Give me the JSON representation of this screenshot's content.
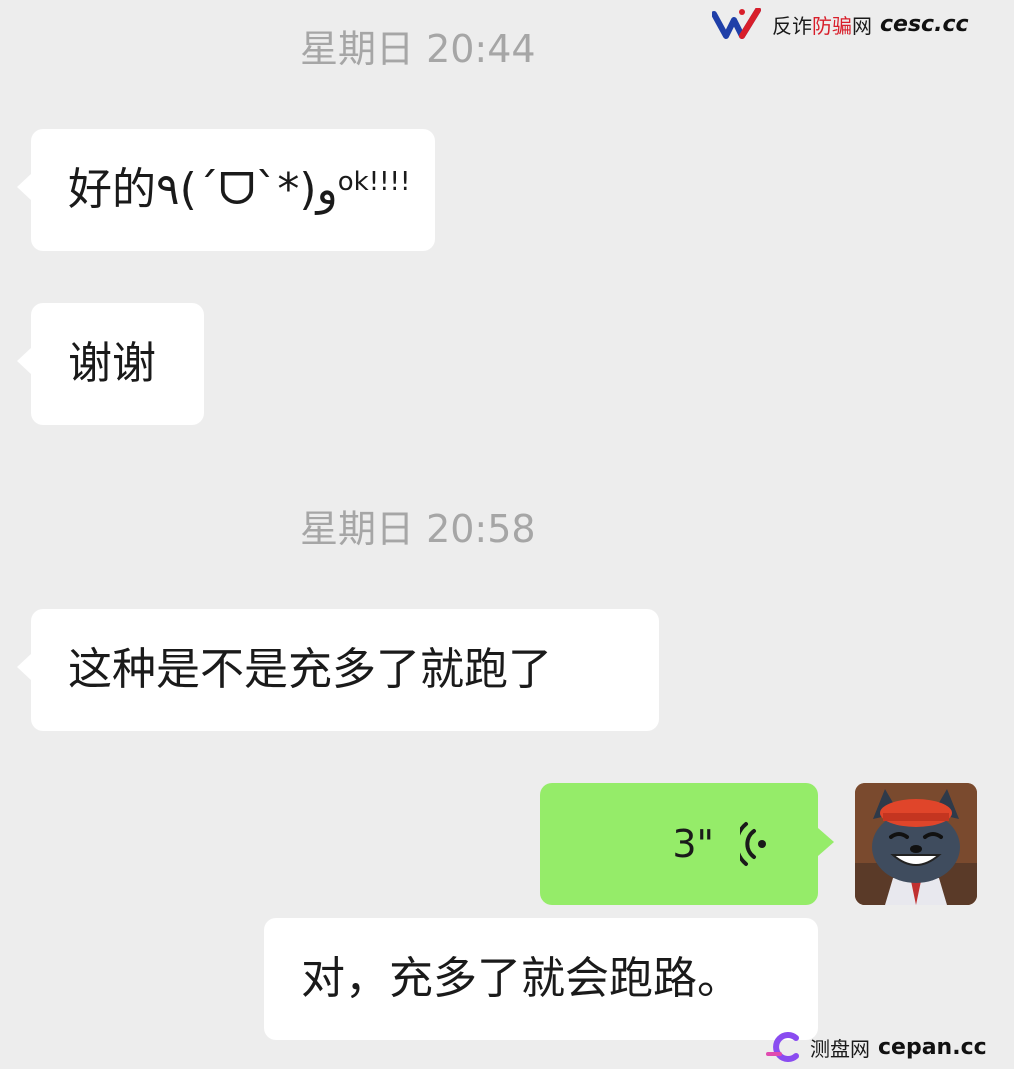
{
  "watermark_top": {
    "brand": "反诈",
    "brand_red": "防骗",
    "brand_tail": "网",
    "url": "cesc.cc"
  },
  "watermark_bottom": {
    "brand": "测盘网",
    "url": "cepan.cc"
  },
  "timestamps": [
    "星期日 20:44",
    "星期日 20:58"
  ],
  "messages": [
    {
      "side": "left",
      "main": "好的٩(ˊᗜˋ*)و",
      "sup": "ok!!!!"
    },
    {
      "side": "left",
      "main": "谢谢"
    },
    {
      "side": "left",
      "main": "这种是不是充多了就跑了"
    },
    {
      "side": "right",
      "type": "voice",
      "duration": "3\""
    },
    {
      "side": "right",
      "main": "对，充多了就会跑路。"
    }
  ],
  "colors": {
    "background": "#ededed",
    "bubble_in": "#ffffff",
    "bubble_voice": "#95ec69",
    "timestamp": "#a6a6a6"
  },
  "icons": {
    "voice": "voice-wave-icon",
    "avatar": "cartoon-wolf-avatar"
  }
}
